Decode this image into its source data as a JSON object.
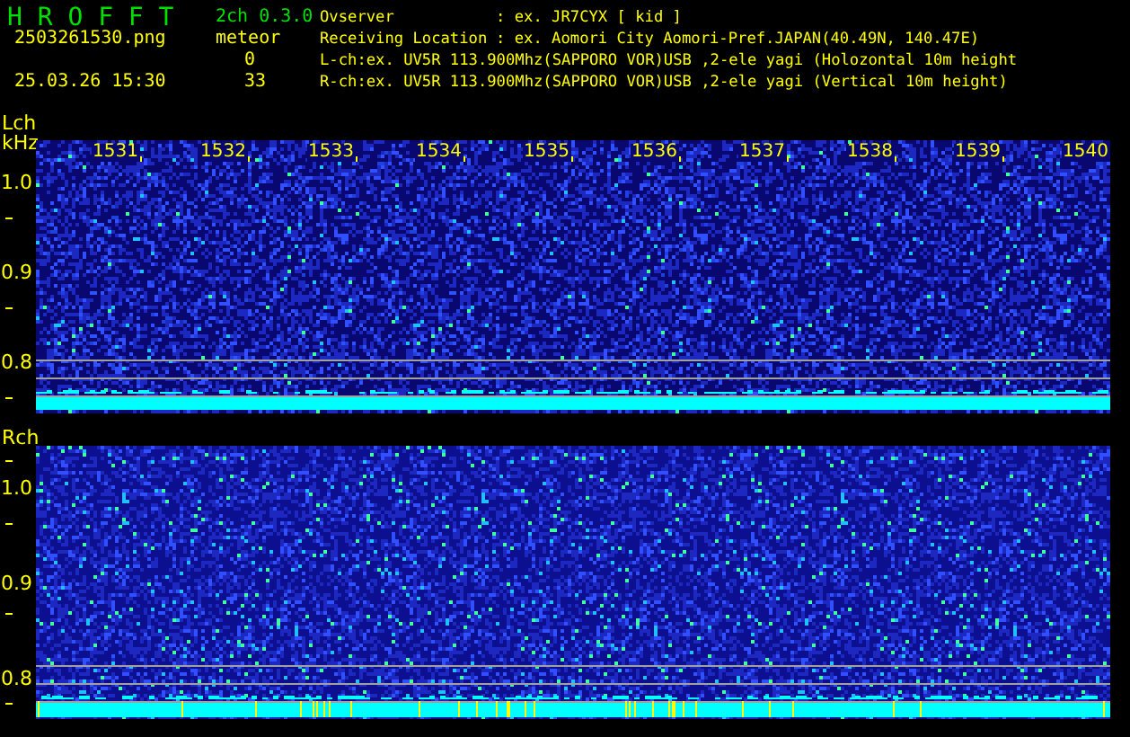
{
  "header": {
    "app_title": "H R O F F T",
    "version": "2ch 0.3.0",
    "filename": "2503261530.png",
    "datetime": "25.03.26 15:30",
    "meteor_label": "meteor",
    "meteor_counts": [
      "0",
      "33"
    ],
    "info": [
      {
        "label": "Ovserver",
        "value": ": ex. JR7CYX [ kid ]"
      },
      {
        "label": "Receiving Location",
        "value": ": ex. Aomori City Aomori-Pref.JAPAN(40.49N, 140.47E)"
      },
      {
        "value": "L-ch:ex. UV5R 113.900Mhz(SAPPORO VOR)USB ,2-ele yagi (Holozontal 10m height"
      },
      {
        "value": "R-ch:ex. UV5R 113.900Mhz(SAPPORO VOR)USB ,2-ele yagi (Vertical 10m height)"
      }
    ]
  },
  "channels": [
    {
      "name": "Lch",
      "unit": "kHz",
      "freq_ticks": [
        "1531",
        "1532",
        "1533",
        "1534",
        "1535",
        "1536",
        "1537",
        "1538",
        "1539",
        "1540"
      ],
      "y_labels": [
        "1.0",
        "0.9",
        "0.8"
      ]
    },
    {
      "name": "Rch",
      "y_labels": [
        "1.0",
        "0.9",
        "0.8"
      ]
    }
  ]
}
